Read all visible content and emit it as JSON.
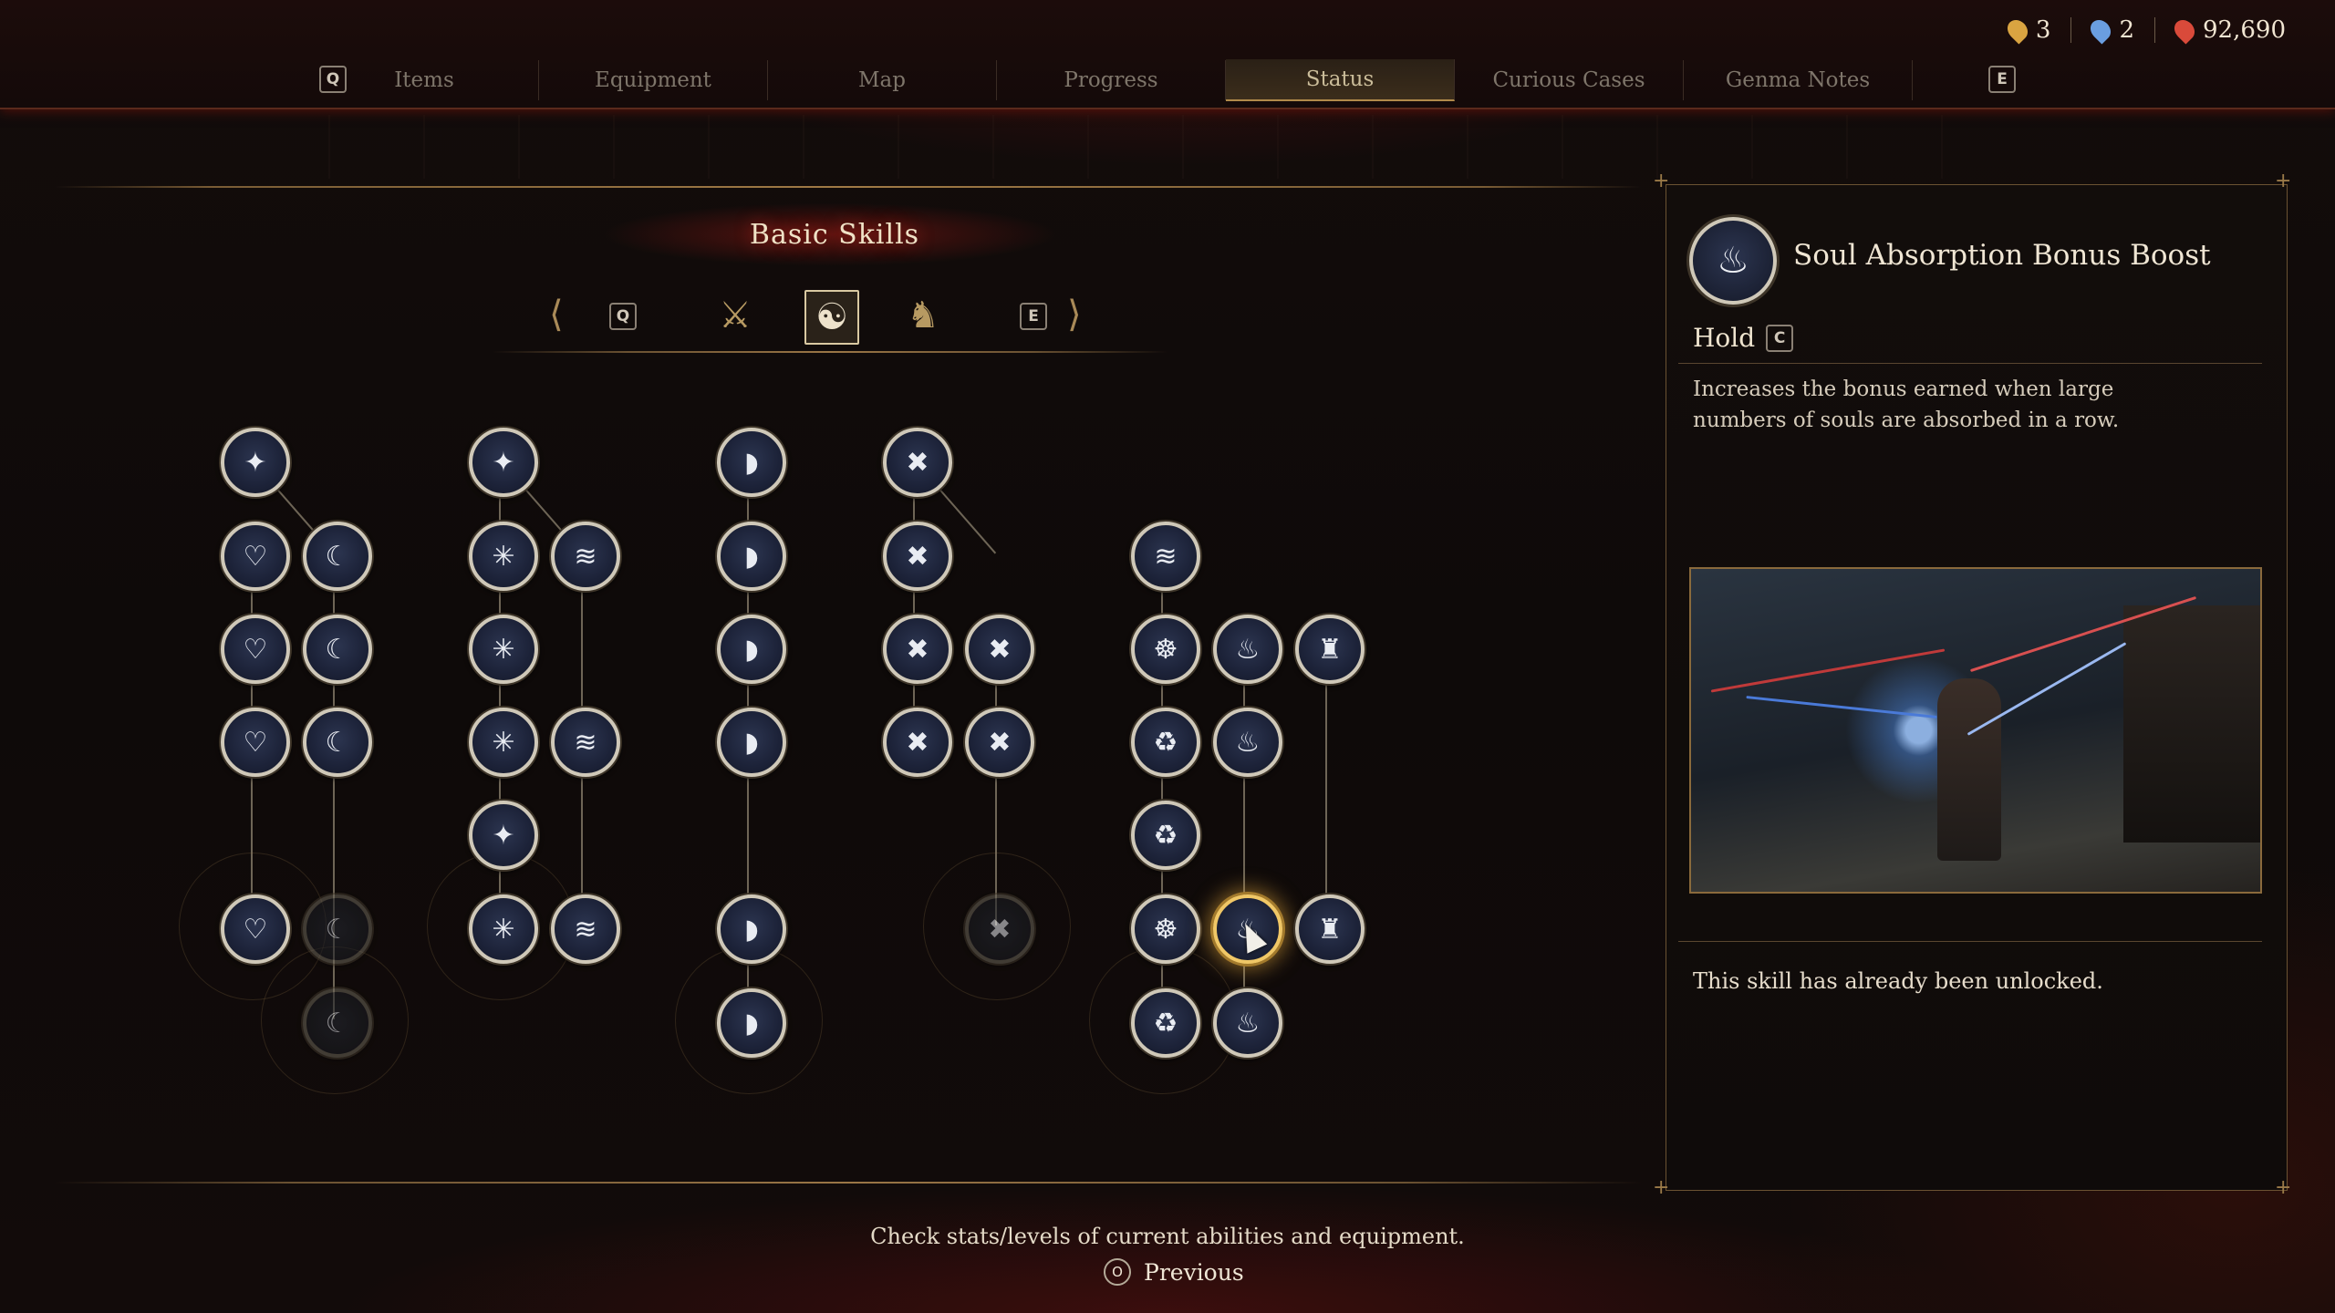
{
  "currency": {
    "items": [
      {
        "name": "key-icon",
        "value": "3",
        "color": "#d9a441"
      },
      {
        "name": "soul-core-icon",
        "value": "2",
        "color": "#6a9ee0"
      },
      {
        "name": "amrita-icon",
        "value": "92,690",
        "color": "#d94a3a"
      }
    ]
  },
  "tabs": {
    "left_key": "Q",
    "right_key": "E",
    "items": [
      "Items",
      "Equipment",
      "Map",
      "Progress",
      "Status",
      "Curious Cases",
      "Genma Notes"
    ],
    "active": "Status"
  },
  "skills_panel": {
    "title": "Basic Skills",
    "left_key": "Q",
    "right_key": "E",
    "categories": [
      {
        "name": "weapon-category-icon",
        "glyph": "⚔"
      },
      {
        "name": "meditation-category-icon",
        "glyph": "☯"
      },
      {
        "name": "guardian-category-icon",
        "glyph": "♞"
      }
    ]
  },
  "detail": {
    "skill_name": "Soul Absorption Bonus Boost",
    "action_label": "Hold",
    "action_key": "C",
    "description": "Increases the bonus earned when large numbers of souls are absorbed in a row.",
    "status": "This skill has already been unlocked."
  },
  "footer": {
    "help_text": "Check stats/levels of current abilities and equipment.",
    "back_button": "O",
    "back_label": "Previous"
  },
  "colors": {
    "accent_gold": "#b08a4a",
    "selected_glow": "#f0c766",
    "background": "#0d0908"
  }
}
